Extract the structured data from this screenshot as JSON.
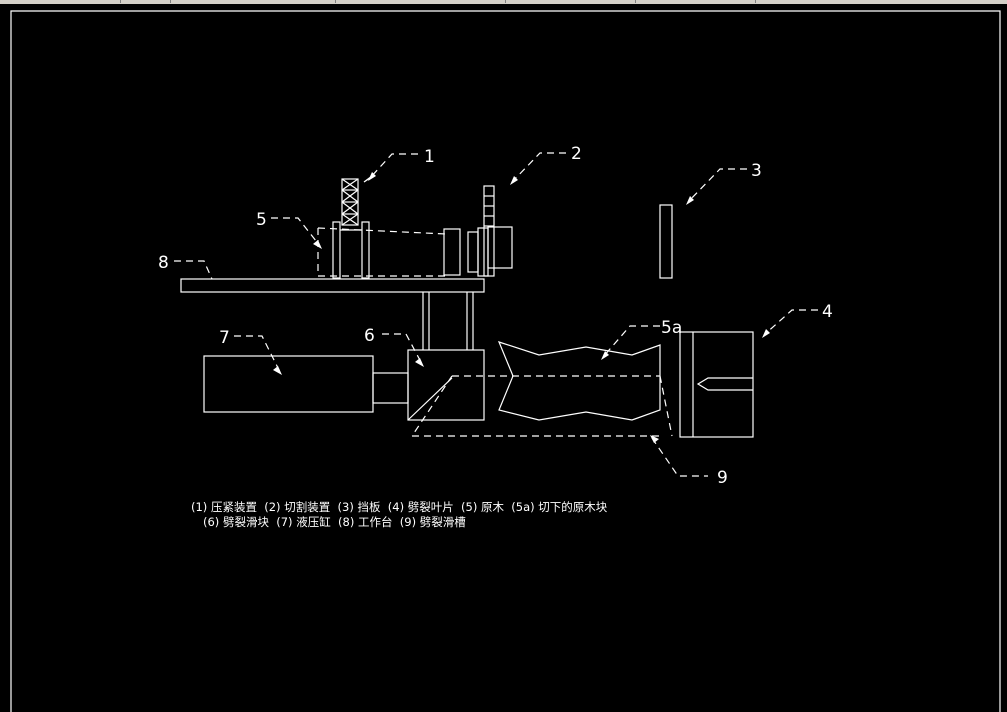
{
  "labels": {
    "l1": "1",
    "l2": "2",
    "l3": "3",
    "l4": "4",
    "l5": "5",
    "l5a": "5a",
    "l6": "6",
    "l7": "7",
    "l8": "8",
    "l9": "9"
  },
  "legend": {
    "line1": "(1) 压紧装置  (2) 切割装置  (3) 挡板  (4) 劈裂叶片  (5) 原木  (5a) 切下的原木块",
    "line2": "(6) 劈裂滑块  (7) 液压缸  (8) 工作台  (9) 劈裂滑槽"
  },
  "colors": {
    "background": "#000000",
    "line": "#ffffff",
    "frame": "#ffffff"
  }
}
